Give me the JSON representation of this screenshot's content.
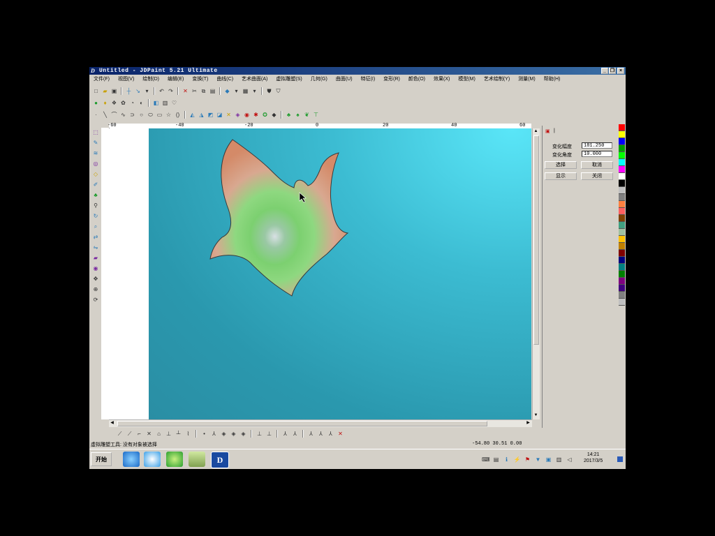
{
  "window": {
    "title": "Untitled - JDPaint 5.21 Ultimate",
    "minimize": "_",
    "restore": "❐",
    "close": "×"
  },
  "menu": [
    "文件(F)",
    "视图(V)",
    "绘制(D)",
    "编辑(E)",
    "变换(T)",
    "曲线(C)",
    "艺术曲面(A)",
    "虚拟雕塑(S)",
    "几何(G)",
    "曲面(U)",
    "特征(I)",
    "变形(R)",
    "颜色(O)",
    "效果(X)",
    "模型(M)",
    "艺术绘制(Y)",
    "测量(M)",
    "帮助(H)"
  ],
  "ruler": {
    "labels": [
      "-60",
      "-40",
      "-20",
      "0",
      "20",
      "40",
      "60"
    ]
  },
  "panel": {
    "tab_label": "|",
    "field1_label": "变化幅度",
    "field1_value": "181.250",
    "field2_label": "变化角度",
    "field2_value": "10.000",
    "btn_select": "选择",
    "btn_cancel": "取消",
    "btn_show": "显示",
    "btn_close": "关闭"
  },
  "palette_colors": [
    "#ff0000",
    "#ffff00",
    "#0000ff",
    "#00a000",
    "#00ff00",
    "#00ffff",
    "#ff00ff",
    "#ffffff",
    "#000000",
    "#c0c0c0",
    "#808080",
    "#ff8040",
    "#ff6060",
    "#804000",
    "#40a080",
    "#a0c0a0",
    "#ffc000",
    "#c08000",
    "#800000",
    "#000080",
    "#008080",
    "#008000",
    "#800080",
    "#400080",
    "#808080",
    "#c0c0c0"
  ],
  "status": {
    "left": "虚拟雕塑工具: 没有对象被选择",
    "coords": "-54.80 30.51 0.00"
  },
  "taskbar": {
    "start": "开始",
    "clock_time": "14:21",
    "clock_date": "2017/3/5"
  }
}
